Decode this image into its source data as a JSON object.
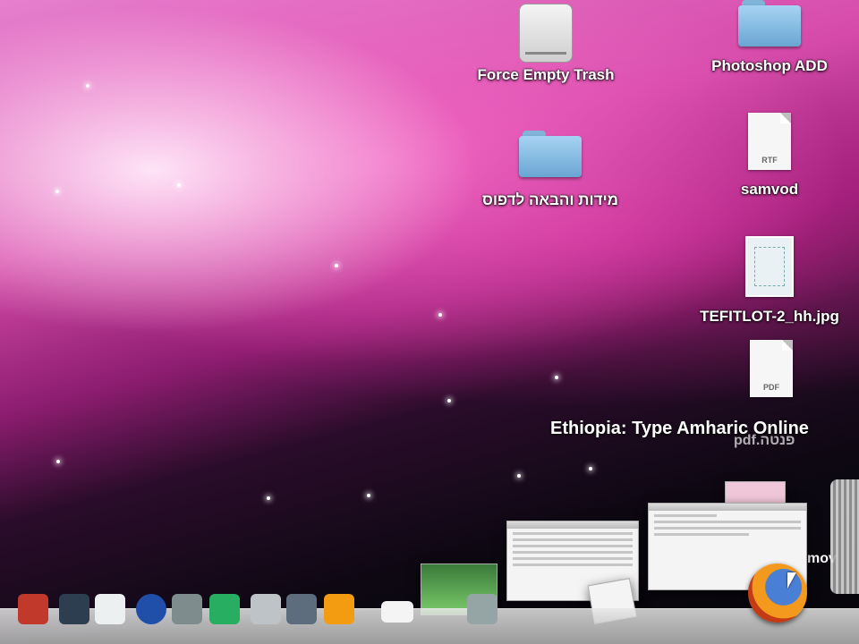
{
  "desktop_icons": [
    {
      "label": "Force Empty Trash",
      "icon": "drive-icon"
    },
    {
      "label": "Photoshop ADD",
      "icon": "folder-icon"
    },
    {
      "label": "מידות והבאה לדפוס",
      "icon": "folder-icon"
    },
    {
      "label": "samvod",
      "icon": "rtf-document-icon",
      "ext": "RTF"
    },
    {
      "label": "TEFITLOT-2_hh.jpg",
      "icon": "image-file-icon"
    },
    {
      "label": "",
      "icon": "pdf-document-icon",
      "ext": "PDF"
    }
  ],
  "tooltip": "Ethiopia: Type Amharic Online",
  "ghost_labels": {
    "under_tooltip": "pdf.פנטה",
    "right_edge": "mov"
  },
  "dock": {
    "colors": [
      "#c0392b",
      "#e67e22",
      "#2c3e50",
      "#ecf0f1",
      "#1f4fa8",
      "#7f8c8d",
      "#27ae60",
      "#bdc3c7",
      "#5d6d7e",
      "#f39c12"
    ]
  }
}
